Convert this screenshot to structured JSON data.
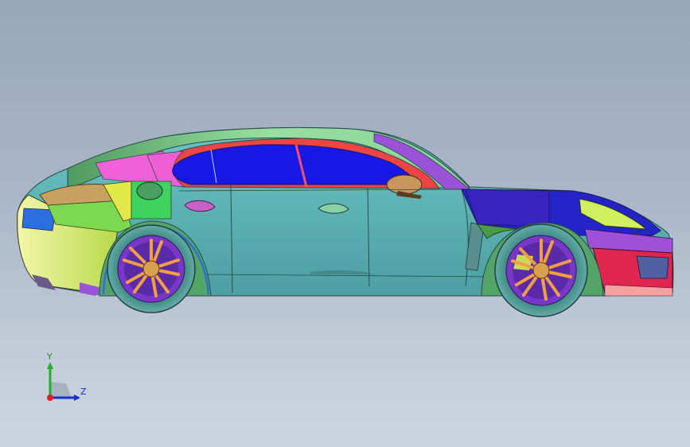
{
  "viewport": {
    "background_top": "#98a6ba",
    "background_bottom": "#ccd5df"
  },
  "model": {
    "name": "car-side-view",
    "colors": {
      "body": "#5fb3b5",
      "glass": "#1a1ae6",
      "roof": "#7fd08a",
      "rear_yellow": "#d7ec4f",
      "front_blue": "#2323c8",
      "front_red": "#e0254e",
      "pink": "#f060d8",
      "green": "#3fd25f",
      "purple": "#9a52d8",
      "wheel_orange": "#f0a040",
      "tire": "#4e9b9a"
    }
  },
  "triad": {
    "y_label": "Y",
    "z_label": "Z",
    "colors": {
      "y": "#22b02a",
      "z": "#1a2fcf",
      "x": "#e02020"
    }
  }
}
